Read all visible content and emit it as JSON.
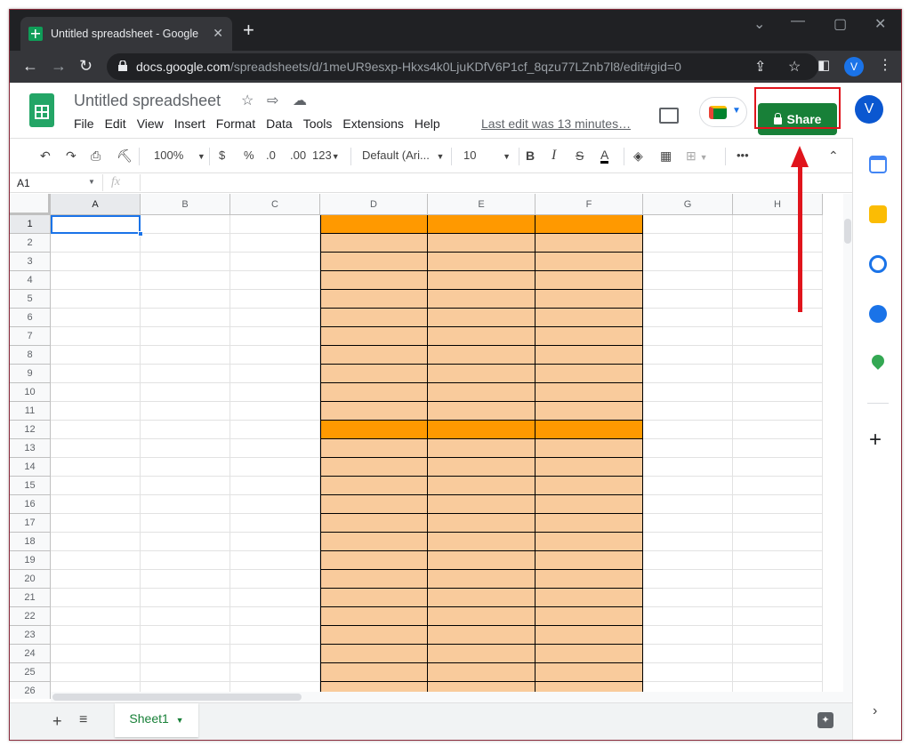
{
  "browser": {
    "tab_title": "Untitled spreadsheet - Google Sh",
    "url_host": "docs.google.com",
    "url_path": "/spreadsheets/d/1meUR9esxp-Hkxs4k0LjuKDfV6P1cf_8qzu77LZnb7l8/edit#gid=0",
    "profile_initial": "V"
  },
  "doc": {
    "title": "Untitled spreadsheet",
    "menu": [
      "File",
      "Edit",
      "View",
      "Insert",
      "Format",
      "Data",
      "Tools",
      "Extensions",
      "Help"
    ],
    "last_edit": "Last edit was 13 minutes…",
    "share_label": "Share",
    "avatar_initial": "V"
  },
  "toolbar": {
    "zoom": "100%",
    "currency": "$",
    "percent": "%",
    "dec_decrease": ".0",
    "dec_increase": ".00",
    "more_formats": "123",
    "font": "Default (Ari...",
    "font_size": "10",
    "bold": "B",
    "italic": "I",
    "strike": "S",
    "text_color": "A",
    "more": "•••"
  },
  "formula_bar": {
    "cell_ref": "A1",
    "fx": "fx",
    "value": ""
  },
  "grid": {
    "columns": [
      "A",
      "B",
      "C",
      "D",
      "E",
      "F",
      "G",
      "H"
    ],
    "rows": [
      "1",
      "2",
      "3",
      "4",
      "5",
      "6",
      "7",
      "8",
      "9",
      "10",
      "11",
      "12",
      "13",
      "14",
      "15",
      "16",
      "17",
      "18",
      "19",
      "20",
      "21",
      "22",
      "23",
      "24",
      "25",
      "26"
    ],
    "header_fill": "#ff9900",
    "body_fill": "#f9cb9c",
    "header_rows": [
      1,
      12
    ],
    "colored_columns": [
      "D",
      "E",
      "F"
    ]
  },
  "sheets": {
    "active_tab": "Sheet1"
  }
}
